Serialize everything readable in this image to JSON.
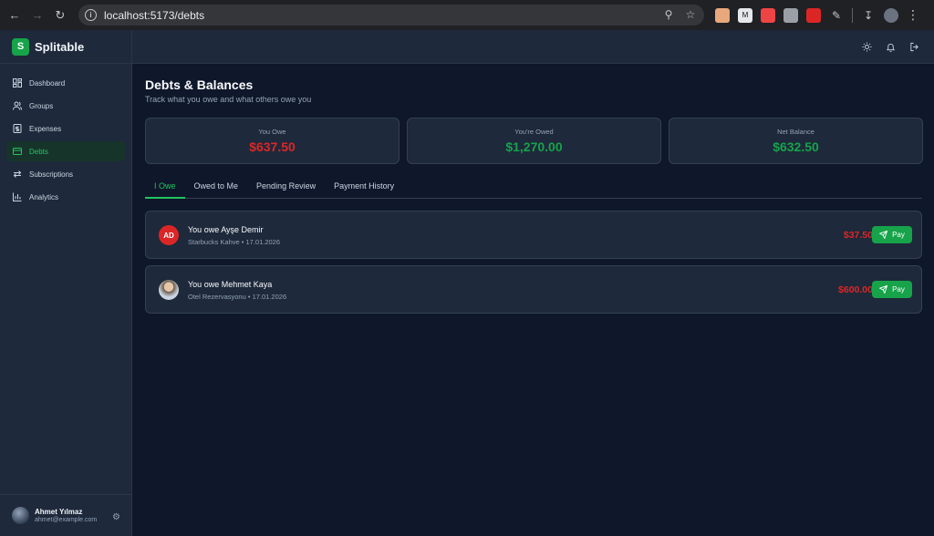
{
  "browser": {
    "url": "localhost:5173/debts",
    "icons": [
      "back-icon",
      "forward-icon",
      "reload-icon",
      "site-info-icon",
      "zoom-icon",
      "bookmark-star-icon",
      "extension-icons",
      "downloads-icon",
      "profile-icon",
      "menu-icon"
    ]
  },
  "app": {
    "name": "Splitable",
    "logo_letter": "S"
  },
  "sidebar": {
    "items": [
      {
        "label": "Dashboard",
        "icon": "dashboard-icon"
      },
      {
        "label": "Groups",
        "icon": "users-icon"
      },
      {
        "label": "Expenses",
        "icon": "receipt-icon"
      },
      {
        "label": "Debts",
        "icon": "card-icon",
        "active": true
      },
      {
        "label": "Subscriptions",
        "icon": "repeat-icon"
      },
      {
        "label": "Analytics",
        "icon": "bar-chart-icon"
      }
    ]
  },
  "user": {
    "name": "Ahmet Yılmaz",
    "email": "ahmet@example.com"
  },
  "page": {
    "title": "Debts & Balances",
    "subtitle": "Track what you owe and what others owe you"
  },
  "stats": [
    {
      "label": "You Owe",
      "value": "$637.50",
      "color": "#dc2626"
    },
    {
      "label": "You're Owed",
      "value": "$1,270.00",
      "color": "#16a34a"
    },
    {
      "label": "Net Balance",
      "value": "$632.50",
      "color": "#16a34a"
    }
  ],
  "tabs": [
    {
      "label": "I Owe",
      "active": true
    },
    {
      "label": "Owed to Me"
    },
    {
      "label": "Pending Review"
    },
    {
      "label": "Payment History"
    }
  ],
  "debts": [
    {
      "initials": "AD",
      "title": "You owe Ayşe Demir",
      "subtitle": "Starbucks Kahve • 17.01.2026",
      "amount": "$37.50",
      "pay_label": "Pay"
    },
    {
      "initials": "",
      "title": "You owe Mehmet Kaya",
      "subtitle": "Otel Rezervasyonu • 17.01.2026",
      "amount": "$600.00",
      "pay_label": "Pay"
    }
  ],
  "colors": {
    "accent": "#22c55e",
    "danger": "#dc2626",
    "background": "#0f172a",
    "card": "#1e293b"
  }
}
